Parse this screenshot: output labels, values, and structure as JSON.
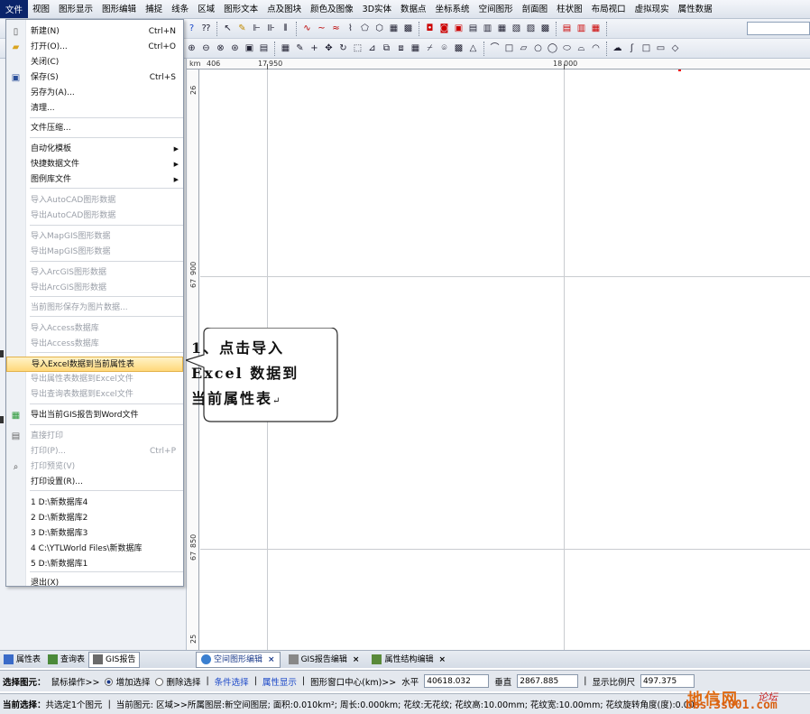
{
  "menubar": {
    "items": [
      "文件",
      "视图",
      "图形显示",
      "图形编辑",
      "捕捉",
      "线条",
      "区域",
      "图形文本",
      "点及图块",
      "颜色及图像",
      "3D实体",
      "数据点",
      "坐标系统",
      "空间图形",
      "剖面图",
      "柱状图",
      "布局视口",
      "虚拟现实",
      "属性数据"
    ]
  },
  "file_menu": {
    "items": [
      {
        "label": "新建(N)",
        "shortcut": "Ctrl+N",
        "icon": "new-document-icon"
      },
      {
        "label": "打开(O)...",
        "shortcut": "Ctrl+O",
        "icon": "open-folder-icon"
      },
      {
        "label": "关闭(C)"
      },
      {
        "label": "保存(S)",
        "shortcut": "Ctrl+S",
        "icon": "save-disk-icon"
      },
      {
        "label": "另存为(A)..."
      },
      {
        "label": "清理..."
      },
      {
        "label": "文件压缩..."
      },
      {
        "label": "自动化模板"
      },
      {
        "label": "快捷数据文件"
      },
      {
        "label": "图例库文件"
      },
      {
        "label": "导入AutoCAD图形数据"
      },
      {
        "label": "导出AutoCAD图形数据"
      },
      {
        "label": "导入MapGIS图形数据"
      },
      {
        "label": "导出MapGIS图形数据"
      },
      {
        "label": "导入ArcGIS图形数据"
      },
      {
        "label": "导出ArcGIS图形数据"
      },
      {
        "label": "当前图形保存为图片数据..."
      },
      {
        "label": "导入Access数据库"
      },
      {
        "label": "导出Access数据库"
      },
      {
        "label": "导入Excel数据到当前属性表"
      },
      {
        "label": "导出属性表数据到Excel文件"
      },
      {
        "label": "导出查询表数据到Excel文件"
      },
      {
        "label": "导出当前GIS报告到Word文件",
        "icon": "word-export-icon"
      },
      {
        "label": "直接打印",
        "icon": "printer-icon"
      },
      {
        "label": "打印(P)...",
        "shortcut": "Ctrl+P"
      },
      {
        "label": "打印预览(V)",
        "icon": "magnifier-icon"
      },
      {
        "label": "打印设置(R)..."
      },
      {
        "label": "1 D:\\新数据库4"
      },
      {
        "label": "2 D:\\新数据库2"
      },
      {
        "label": "3 D:\\新数据库3"
      },
      {
        "label": "4 C:\\YTLWorld Files\\新数据库"
      },
      {
        "label": "5 D:\\新数据库1"
      },
      {
        "label": "退出(X)"
      }
    ]
  },
  "callout": {
    "line1": "1、点击导入",
    "line2": "Excel 数据到",
    "line3": "当前属性表",
    "return_mark": "↵"
  },
  "rulers": {
    "top": [
      "406",
      "17",
      "950",
      "18",
      "000"
    ],
    "left": [
      "26",
      "67",
      "900",
      "67",
      "850",
      "25"
    ]
  },
  "left_tabs": [
    "属性表",
    "查询表",
    "GIS报告"
  ],
  "doc_tabs": [
    {
      "label": "空间图形编辑",
      "close": "×"
    },
    {
      "label": "GIS报告编辑",
      "close": "×"
    },
    {
      "label": "属性结构编辑",
      "close": "×"
    }
  ],
  "status1": {
    "select_label": "选择图元：",
    "mouse_label": "鼠标操作>>",
    "add_select": "增加选择",
    "remove_select": "删除选择",
    "cond_select": "条件选择",
    "attr_show": "属性显示",
    "center_label": "图形窗口中心(km)>>",
    "horizontal_label": "水平",
    "horizontal_value": "40618.032",
    "vertical_label": "垂直",
    "vertical_value": "2867.885",
    "scale_label": "显示比例尺",
    "scale_value": "497.375"
  },
  "status2": {
    "current_select_label": "当前选择：",
    "current_select_value": "共选定1个图元",
    "current_elem_label": "当前图元:",
    "current_elem_value": "区域>>所属图层:新空间图层; 面积:0.010km²; 周长:0.000km; 花纹:无花纹; 花纹高:10.00mm; 花纹宽:10.00mm; 花纹旋转角度(度):0.00"
  },
  "watermark": {
    "main": "地信网",
    "sub": "论坛",
    "url": "bbs.3s001.com"
  },
  "colors": {
    "menu_highlight": "#ffd87a",
    "callout_border": "#2a2a2a",
    "watermark": "#e06a10"
  }
}
